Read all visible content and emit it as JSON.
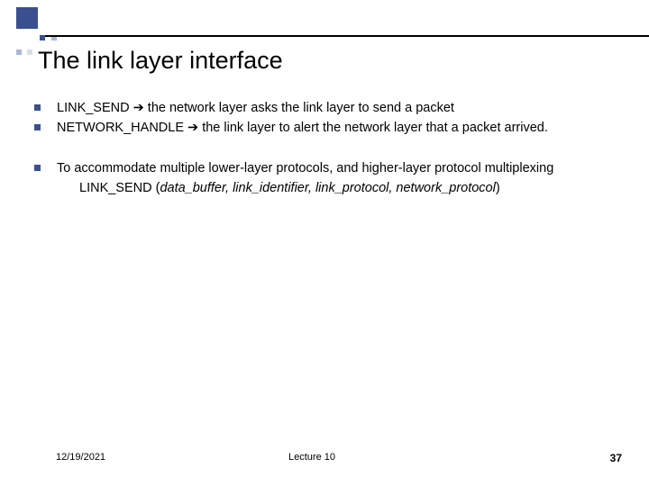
{
  "title": "The link layer interface",
  "bullets_group1": [
    {
      "parts": [
        {
          "text": "LINK_SEND ",
          "style": ""
        },
        {
          "text": "➔",
          "style": "arrow"
        },
        {
          "text": " the network layer asks the link layer to send a packet",
          "style": ""
        }
      ]
    },
    {
      "parts": [
        {
          "text": "NETWORK_HANDLE ",
          "style": ""
        },
        {
          "text": "➔",
          "style": "arrow"
        },
        {
          "text": " the link layer to alert the network layer that a packet arrived.",
          "style": ""
        }
      ]
    }
  ],
  "bullets_group2": [
    {
      "parts": [
        {
          "text": "To accommodate multiple lower-layer protocols, and higher-layer protocol multiplexing",
          "style": ""
        }
      ],
      "subline": "LINK_SEND (data_buffer, link_identifier, link_protocol, network_protocol)"
    }
  ],
  "footer": {
    "date": "12/19/2021",
    "lecture": "Lecture 10",
    "page": "37"
  }
}
